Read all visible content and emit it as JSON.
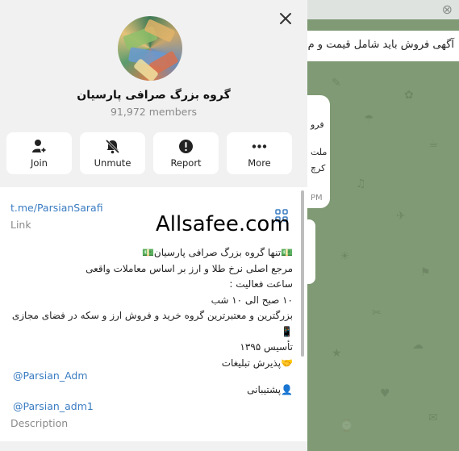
{
  "background": {
    "banner_text": "آگهی فروش باید شامل قیمت و م",
    "bubble_fragments": [
      "فرو",
      "ملت",
      "کرچ",
      "PM"
    ]
  },
  "header": {
    "close_icon": "close-icon",
    "group_name": "گروه بزرگ صرافی پارسیان",
    "members": "91,972 members"
  },
  "actions": [
    {
      "label": "Join",
      "icon": "person-add-icon"
    },
    {
      "label": "Unmute",
      "icon": "bell-off-icon"
    },
    {
      "label": "Report",
      "icon": "alert-icon"
    },
    {
      "label": "More",
      "icon": "more-dots-icon"
    }
  ],
  "info": {
    "link_value": "t.me/ParsianSarafi",
    "link_label": "Link",
    "watermark": "Allsafee.com",
    "description_lines": [
      "💵تنها گروه بزرگ صرافی پارسیان💵",
      "مرجع اصلی نرخ طلا و ارز بر اساس معاملات واقعی",
      "ساعت فعالیت :",
      "۱۰ صبح الی ۱۰ شب",
      "بزرگترین و معتبرترین گروه خرید و فروش ارز و سکه در فضای مجازی",
      "📱",
      "تأسیس ۱۳۹۵",
      "🤝پذیرش تبلیغات"
    ],
    "mention_1": "@Parsian_Adm",
    "support_line": "👤پشتیبانی",
    "mention_2": "@Parsian_adm1",
    "description_label": "Description"
  },
  "colors": {
    "accent_link": "#3a7cc2",
    "panel_bg": "#f1f1f1",
    "chat_bg": "#7f9a74"
  }
}
